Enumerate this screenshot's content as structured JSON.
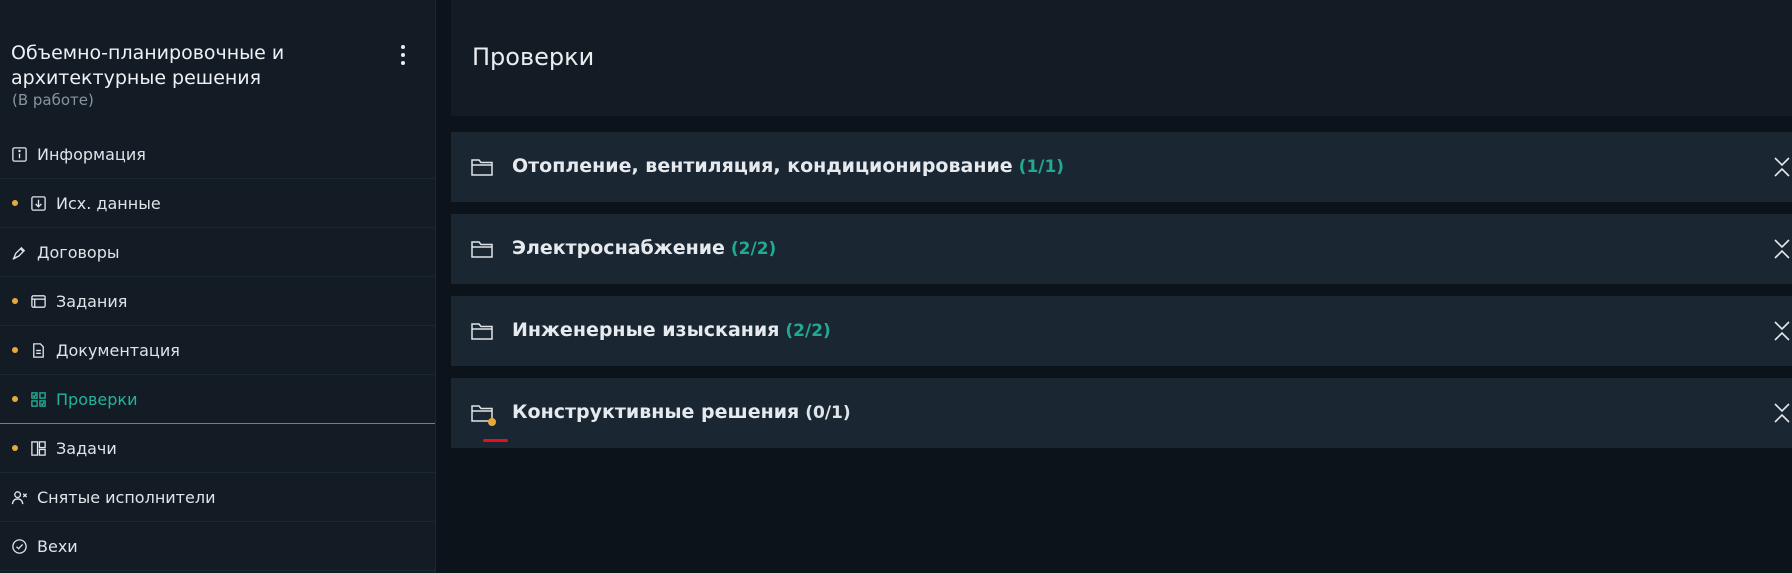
{
  "sidebar": {
    "title": "Объемно-планировочные и архитектурные решения",
    "status": "(В работе)",
    "menu_icon": "kebab-vertical-icon",
    "items": [
      {
        "label": "Информация",
        "icon": "info-icon",
        "dot": false,
        "active": false
      },
      {
        "label": "Исх. данные",
        "icon": "download-icon",
        "dot": true,
        "active": false
      },
      {
        "label": "Договоры",
        "icon": "pen-icon",
        "dot": false,
        "active": false
      },
      {
        "label": "Задания",
        "icon": "window-icon",
        "dot": true,
        "active": false
      },
      {
        "label": "Документация",
        "icon": "document-icon",
        "dot": true,
        "active": false
      },
      {
        "label": "Проверки",
        "icon": "grid-check-icon",
        "dot": true,
        "active": true
      },
      {
        "label": "Задачи",
        "icon": "board-icon",
        "dot": true,
        "active": false
      },
      {
        "label": "Снятые исполнители",
        "icon": "user-remove-icon",
        "dot": false,
        "active": false
      },
      {
        "label": "Вехи",
        "icon": "check-circle-icon",
        "dot": false,
        "active": false
      }
    ]
  },
  "main": {
    "title": "Проверки",
    "groups": [
      {
        "name": "Отопление, вентиляция, кондиционирование",
        "count": "(1/1)",
        "complete": true
      },
      {
        "name": "Электроснабжение",
        "count": "(2/2)",
        "complete": true
      },
      {
        "name": "Инженерные изыскания",
        "count": "(2/2)",
        "complete": true
      },
      {
        "name": "Конструктивные решения",
        "count": "(0/1)",
        "complete": false
      }
    ]
  },
  "colors": {
    "accent": "#21b39d",
    "dot": "#e9a93a",
    "sidebar_bg": "#131c25",
    "card_bg": "#1a2733",
    "page_bg": "#0d131b",
    "alert_underline": "#e0131b"
  }
}
